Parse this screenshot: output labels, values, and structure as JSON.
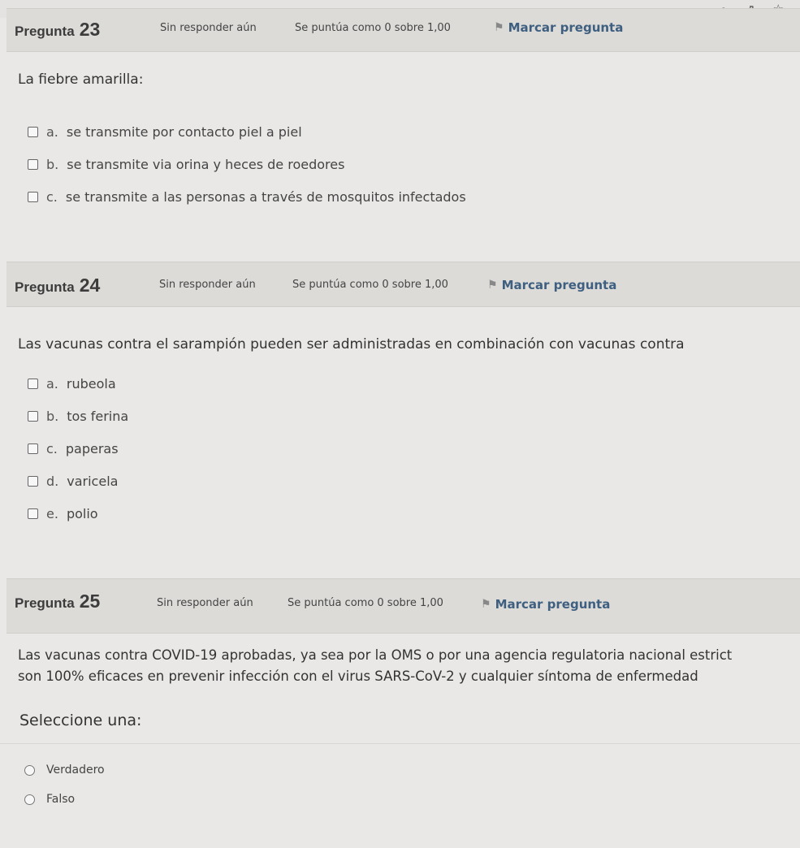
{
  "browser": {
    "icons": [
      "search-icon",
      "share-icon",
      "star-icon"
    ],
    "glyphs": {
      "search": "⌕",
      "share": "⇗",
      "star": "☆"
    }
  },
  "questions": [
    {
      "title": "Pregunta",
      "number": "23",
      "status": "Sin responder aún",
      "grade": "Se puntúa como 0 sobre 1,00",
      "flag_label": "Marcar pregunta",
      "text": "La fiebre amarilla:",
      "answers": [
        {
          "letter": "a.",
          "text": "se transmite por contacto piel a piel"
        },
        {
          "letter": "b.",
          "text": "se transmite via orina y heces de roedores"
        },
        {
          "letter": "c.",
          "text": "se transmite a las personas a través de mosquitos infectados"
        }
      ]
    },
    {
      "title": "Pregunta",
      "number": "24",
      "status": "Sin responder aún",
      "grade": "Se puntúa como 0 sobre 1,00",
      "flag_label": "Marcar pregunta",
      "text": "Las vacunas contra el sarampión pueden ser administradas en combinación con vacunas contra",
      "answers": [
        {
          "letter": "a.",
          "text": "rubeola"
        },
        {
          "letter": "b.",
          "text": "tos ferina"
        },
        {
          "letter": "c.",
          "text": "paperas"
        },
        {
          "letter": "d.",
          "text": "varicela"
        },
        {
          "letter": "e.",
          "text": "polio"
        }
      ]
    },
    {
      "title": "Pregunta",
      "number": "25",
      "status": "Sin responder aún",
      "grade": "Se puntúa como 0 sobre 1,00",
      "flag_label": "Marcar pregunta",
      "text_line1": "Las vacunas contra COVID-19 aprobadas, ya sea por la OMS o por una agencia regulatoria nacional estrict",
      "text_line2": "son 100% eficaces en prevenir infección con el virus SARS-CoV-2 y cualquier síntoma de enfermedad",
      "prompt": "Seleccione una:",
      "answers": [
        {
          "text": "Verdadero"
        },
        {
          "text": "Falso"
        }
      ]
    }
  ],
  "flag_glyph": "⚑"
}
